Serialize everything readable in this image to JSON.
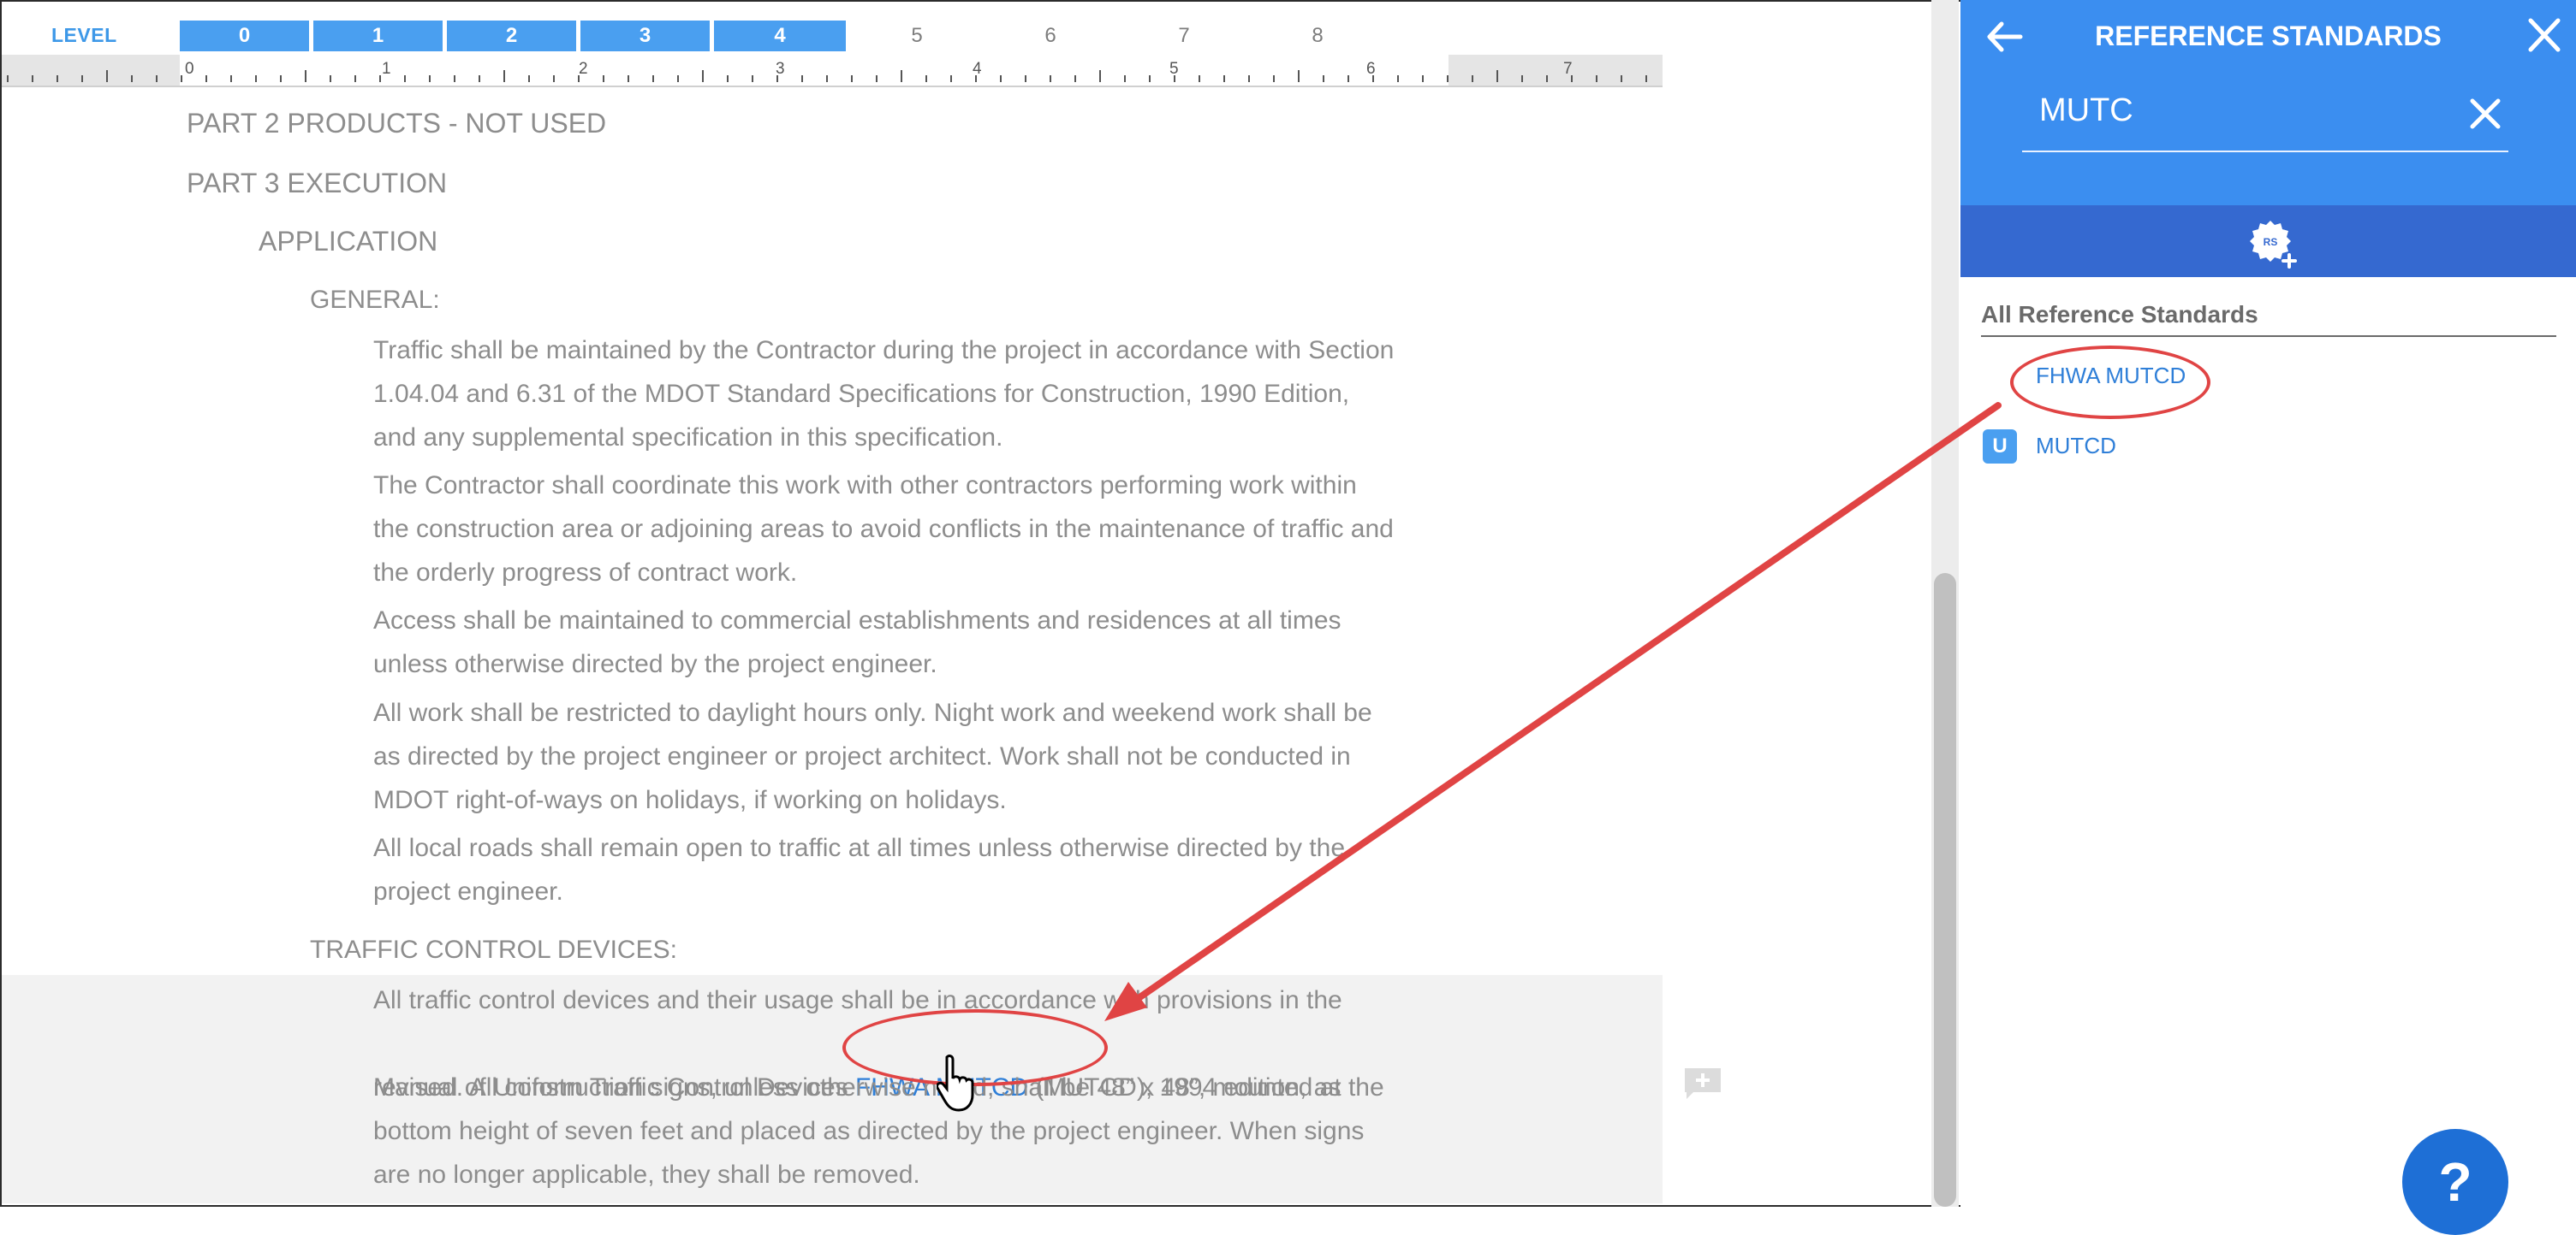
{
  "levels": {
    "label": "LEVEL",
    "items": [
      {
        "label": "0",
        "active": true
      },
      {
        "label": "1",
        "active": true
      },
      {
        "label": "2",
        "active": true
      },
      {
        "label": "3",
        "active": true
      },
      {
        "label": "4",
        "active": true
      },
      {
        "label": "5",
        "active": false
      },
      {
        "label": "6",
        "active": false
      },
      {
        "label": "7",
        "active": false
      },
      {
        "label": "8",
        "active": false
      }
    ]
  },
  "ruler": {
    "numbers": [
      "0",
      "1",
      "2",
      "3",
      "4",
      "5",
      "6",
      "7"
    ]
  },
  "document": {
    "part2": "PART 2 PRODUCTS - NOT USED",
    "part3": "PART 3 EXECUTION",
    "application": "APPLICATION",
    "general": "GENERAL:",
    "para1": "Traffic shall be maintained by the Contractor during the project in accordance with Section\n1.04.04 and 6.31 of the MDOT Standard Specifications for Construction, 1990 Edition,\nand any supplemental specification in this specification.",
    "para2": "The Contractor shall coordinate this work with other contractors performing work within\nthe construction area or adjoining areas to avoid conflicts in the maintenance of traffic and\nthe orderly progress of contract work.",
    "para3": "Access shall be maintained to commercial establishments and residences at all times\nunless otherwise directed by the project engineer.",
    "para4": "All work shall be restricted to daylight hours only.  Night work and weekend work shall be\nas directed by the project engineer or project architect.  Work shall not be conducted in\nMDOT right-of-ways on holidays, if working on holidays.",
    "para5": "All local roads shall remain open to traffic at all times unless otherwise directed by the\nproject engineer.",
    "traffic_heading": "TRAFFIC CONTROL DEVICES:",
    "tcd_line1": "All traffic control devices and their usage shall be in accordance with provisions in the",
    "tcd_line2_before": "Manual of Uniform Traffic Control Devices ",
    "tcd_link": "FHWA MUTCD",
    "tcd_line2_after": " (MUTCD), 1994 edition, as",
    "tcd_rest": "revised.  All construction signs, unless otherwise noted, shall be 48” x 48”, mounted at the\nbottom height of seven feet and placed as directed by the project engineer.  When signs\nare no longer applicable, they shall be removed."
  },
  "panel": {
    "title": "REFERENCE STANDARDS",
    "search_value": "MUTC",
    "toolbar_icon": "rs-add-icon",
    "section_title": "All Reference Standards",
    "items": [
      {
        "label": "FHWA MUTCD",
        "badge": ""
      },
      {
        "label": "MUTCD",
        "badge": "U"
      }
    ],
    "help": "?"
  },
  "colors": {
    "accent": "#3b8ef0",
    "toolbar": "#3569d0",
    "link": "#2f7fd8",
    "annotation": "#e04444"
  }
}
